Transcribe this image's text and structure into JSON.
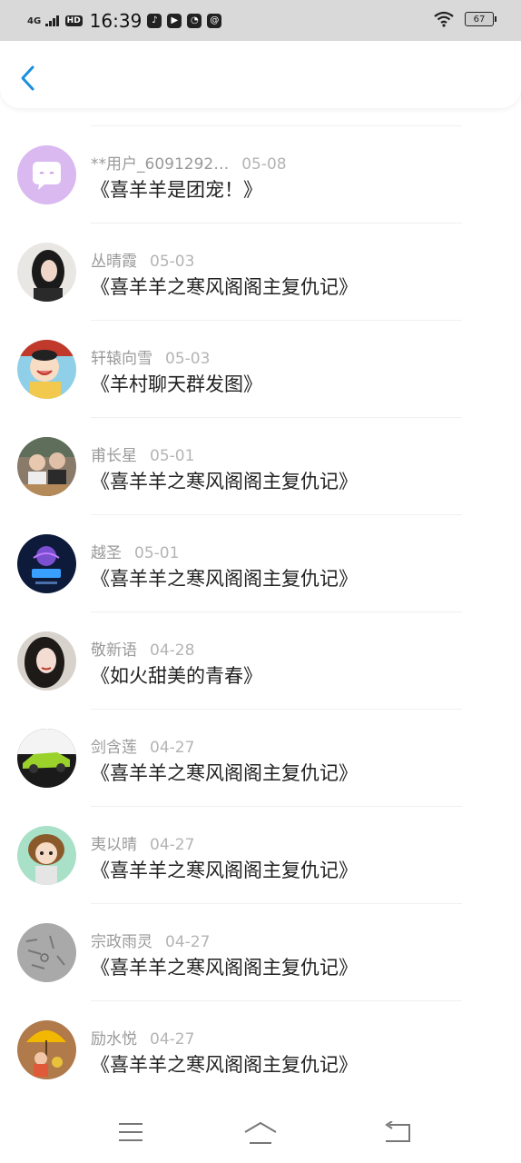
{
  "status": {
    "network": "4G",
    "hd": "HD",
    "time": "16:39",
    "battery": "67"
  },
  "comments": [
    {
      "user": "**用户_6091292…",
      "date": "05-08",
      "title": "《喜羊羊是团宠！》"
    },
    {
      "user": "丛晴霞",
      "date": "05-03",
      "title": "《喜羊羊之寒风阁阁主复仇记》"
    },
    {
      "user": "轩辕向雪",
      "date": "05-03",
      "title": "《羊村聊天群发图》"
    },
    {
      "user": "甫长星",
      "date": "05-01",
      "title": "《喜羊羊之寒风阁阁主复仇记》"
    },
    {
      "user": "越圣",
      "date": "05-01",
      "title": "《喜羊羊之寒风阁阁主复仇记》"
    },
    {
      "user": "敬新语",
      "date": "04-28",
      "title": "《如火甜美的青春》"
    },
    {
      "user": "剑含莲",
      "date": "04-27",
      "title": "《喜羊羊之寒风阁阁主复仇记》"
    },
    {
      "user": "夷以晴",
      "date": "04-27",
      "title": "《喜羊羊之寒风阁阁主复仇记》"
    },
    {
      "user": "宗政雨灵",
      "date": "04-27",
      "title": "《喜羊羊之寒风阁阁主复仇记》"
    },
    {
      "user": "励水悦",
      "date": "04-27",
      "title": "《喜羊羊之寒风阁阁主复仇记》"
    }
  ],
  "icons": {
    "back": "back-arrow-icon",
    "menu": "menu-icon",
    "home": "home-icon",
    "return": "return-icon"
  },
  "colors": {
    "accent": "#1a8fe0",
    "statusbar": "#d9d9d9",
    "username": "#9a9a9a",
    "date": "#b4b4b4",
    "title": "#222222"
  }
}
